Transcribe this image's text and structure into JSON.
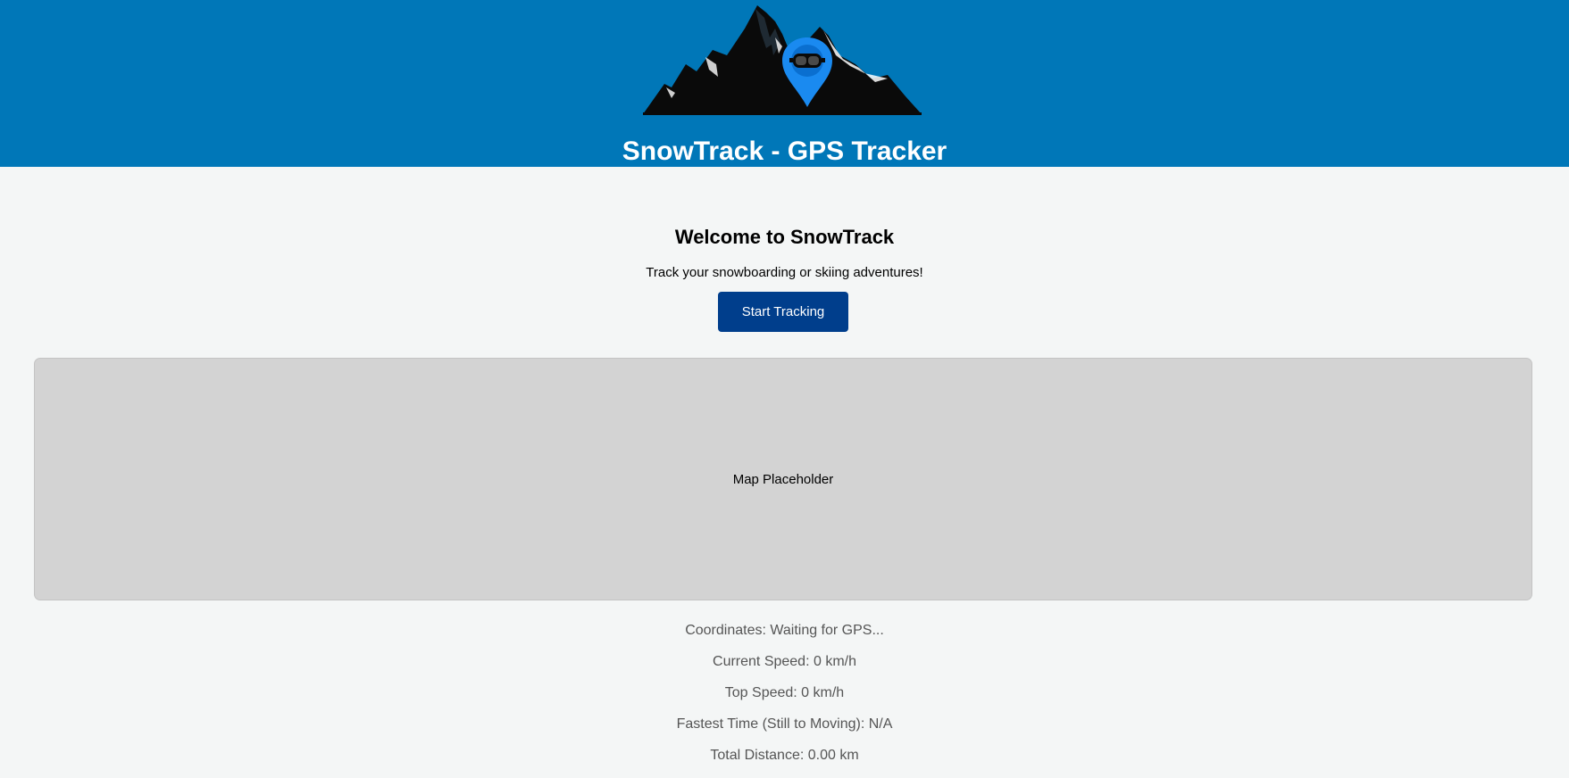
{
  "header": {
    "logo_icon": "mountain-goggles-pin-icon",
    "title": "SnowTrack - GPS Tracker",
    "background_color": "#0077b8"
  },
  "welcome": {
    "heading": "Welcome to SnowTrack",
    "tagline": "Track your snowboarding or skiing adventures!",
    "start_button_label": "Start Tracking",
    "button_color": "#003e8c"
  },
  "map": {
    "placeholder": "Map Placeholder"
  },
  "stats": {
    "coordinates": "Coordinates: Waiting for GPS...",
    "current_speed": "Current Speed: 0 km/h",
    "top_speed": "Top Speed: 0 km/h",
    "fastest_time": "Fastest Time (Still to Moving): N/A",
    "total_distance": "Total Distance: 0.00 km"
  }
}
